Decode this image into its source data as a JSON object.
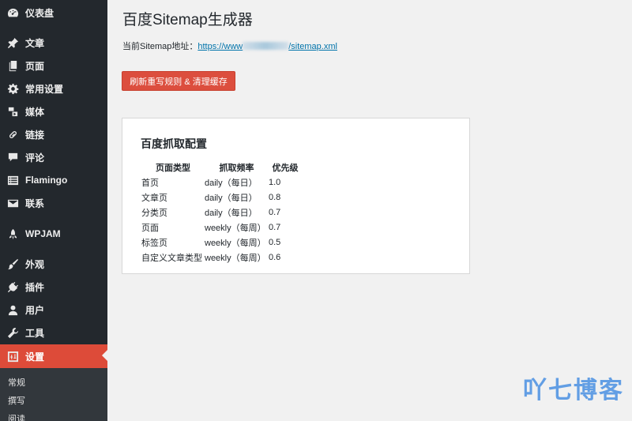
{
  "sidebar": {
    "items": [
      {
        "label": "仪表盘",
        "icon": "dashboard-icon"
      },
      {
        "label": "文章",
        "icon": "pin-icon"
      },
      {
        "label": "页面",
        "icon": "pages-icon"
      },
      {
        "label": "常用设置",
        "icon": "gear-icon"
      },
      {
        "label": "媒体",
        "icon": "media-icon"
      },
      {
        "label": "链接",
        "icon": "link-icon"
      },
      {
        "label": "评论",
        "icon": "comment-icon"
      },
      {
        "label": "Flamingo",
        "icon": "list-icon"
      },
      {
        "label": "联系",
        "icon": "mail-icon"
      },
      {
        "label": "WPJAM",
        "icon": "rocket-icon"
      },
      {
        "label": "外观",
        "icon": "brush-icon"
      },
      {
        "label": "插件",
        "icon": "plugin-icon"
      },
      {
        "label": "用户",
        "icon": "user-icon"
      },
      {
        "label": "工具",
        "icon": "wrench-icon"
      },
      {
        "label": "设置",
        "icon": "settings-icon"
      }
    ],
    "submenu": [
      "常规",
      "撰写",
      "阅读"
    ],
    "active_color": "#dd4b39"
  },
  "main": {
    "title": "百度Sitemap生成器",
    "sitemap_label": "当前Sitemap地址：",
    "sitemap_url_prefix": "https://www",
    "sitemap_url_suffix": "/sitemap.xml",
    "refresh_button": "刷新重写规则 & 清理缓存",
    "card": {
      "title": "百度抓取配置",
      "headers": [
        "页面类型",
        "抓取频率",
        "优先级"
      ],
      "rows": [
        [
          "首页",
          "daily（每日）",
          "1.0"
        ],
        [
          "文章页",
          "daily（每日）",
          "0.8"
        ],
        [
          "分类页",
          "daily（每日）",
          "0.7"
        ],
        [
          "页面",
          "weekly（每周）",
          "0.7"
        ],
        [
          "标签页",
          "weekly（每周）",
          "0.5"
        ],
        [
          "自定义文章类型",
          "weekly（每周）",
          "0.6"
        ]
      ]
    }
  },
  "watermark": "吖七博客"
}
